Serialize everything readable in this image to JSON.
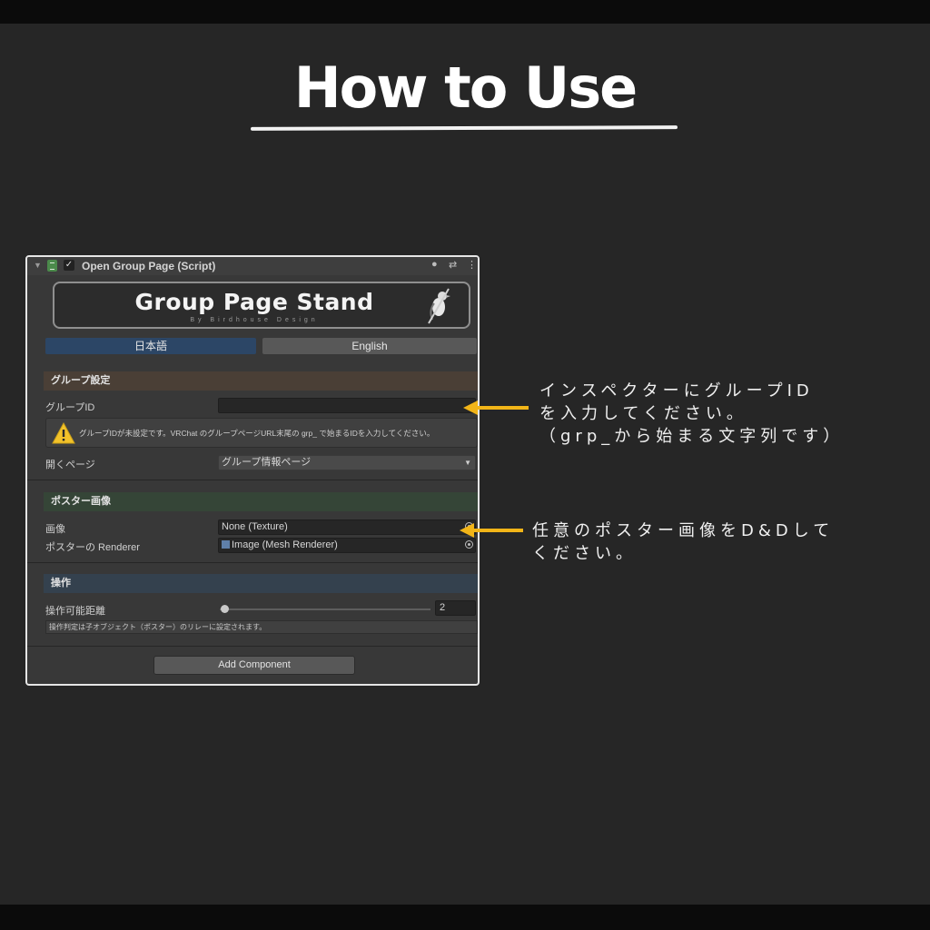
{
  "title": "How to Use",
  "component": {
    "title": "Open Group Page (Script)",
    "enabled_mark": "✓",
    "header_icons": [
      "help-icon",
      "settings-sliders-icon",
      "kebab-menu-icon"
    ]
  },
  "banner": {
    "title": "Group Page Stand",
    "subtitle": "By Birdhouse Design"
  },
  "language_tabs": [
    {
      "label": "日本語",
      "active": true
    },
    {
      "label": "English",
      "active": false
    }
  ],
  "group_section": {
    "header": "グループ設定",
    "group_id_label": "グループID",
    "group_id_value": "",
    "warning_text": "グループIDが未設定です。VRChat のグループページURL末尾の grp_ で始まるIDを入力してください。",
    "open_page_label": "開くページ",
    "open_page_value": "グループ情報ページ"
  },
  "poster_section": {
    "header": "ポスター画像",
    "image_label": "画像",
    "image_value": "None (Texture)",
    "renderer_label": "ポスターの Renderer",
    "renderer_value": "Image (Mesh Renderer)"
  },
  "operation_section": {
    "header": "操作",
    "distance_label": "操作可能距離",
    "distance_value": "2",
    "note": "操作判定は子オブジェクト（ポスター）のリレーに設定されます。"
  },
  "add_component_label": "Add Component",
  "annotations": {
    "group_id": "インスペクターにグループID\nを入力してください。\n（grp_から始まる文字列です）",
    "poster": "任意のポスター画像をD&Dして\nください。"
  },
  "colors": {
    "accent_arrow": "#f2b518",
    "tab_active": "#2c4666",
    "section_group": "#4a3f36",
    "section_poster": "#354537",
    "section_operation": "#34414e"
  }
}
